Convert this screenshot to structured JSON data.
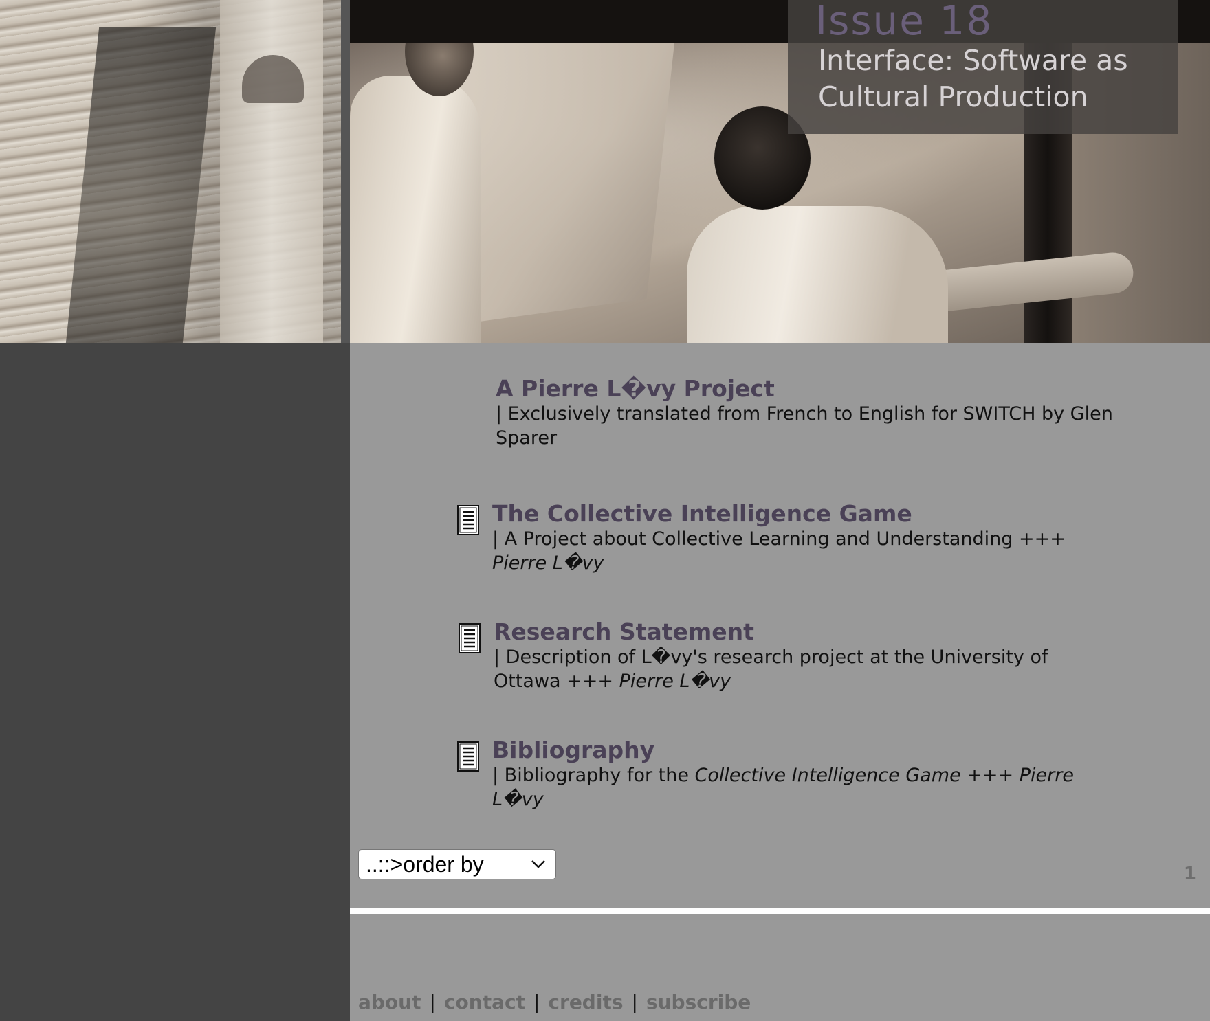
{
  "header": {
    "issue": "Issue 18",
    "subtitle": "Interface: Software as Cultural Production"
  },
  "project": {
    "title": "A Pierre L�vy Project",
    "description": "| Exclusively translated from French to English for SWITCH by Glen Sparer"
  },
  "articles": [
    {
      "title": "The Collective Intelligence Game",
      "description": "| A Project about Collective Learning and Understanding +++ ",
      "author": "Pierre L�vy",
      "icon": "document-icon"
    },
    {
      "title": "Research Statement",
      "description": "| Description of L�vy's research project at the University of Ottawa +++ ",
      "author": "Pierre L�vy",
      "icon": "document-icon"
    },
    {
      "title": "Bibliography",
      "description_prefix": "| Bibliography for the ",
      "description_italic": "Collective Intelligence Game +++ Pierre L�vy",
      "icon": "document-icon"
    }
  ],
  "controls": {
    "order_by": "..::>order by",
    "page_number": "1"
  },
  "footer": {
    "links": [
      "about",
      "contact",
      "credits",
      "subscribe"
    ],
    "separator": "|"
  },
  "colors": {
    "page_bg": "#444444",
    "panel_bg": "#999999",
    "title_color": "#4a4156",
    "issue_color": "#6a5f7a",
    "footer_link": "#6a6a6a"
  }
}
